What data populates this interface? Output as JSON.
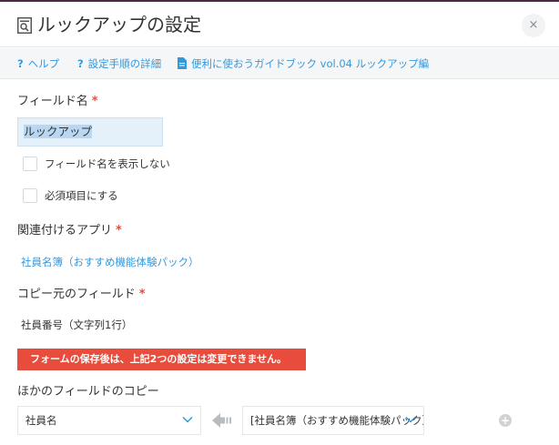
{
  "header": {
    "title": "ルックアップの設定",
    "title_icon": "lookup-search-icon",
    "close_label": "×"
  },
  "helpbar": {
    "links": [
      {
        "icon": "question-icon",
        "icon_glyph": "?",
        "label": "ヘルプ"
      },
      {
        "icon": "question-icon",
        "icon_glyph": "?",
        "label": "設定手順の詳細"
      },
      {
        "icon": "document-icon",
        "label": "便利に使おうガイドブック vol.04 ルックアップ編"
      }
    ]
  },
  "form": {
    "field_name": {
      "label": "フィールド名",
      "required_mark": "*",
      "value": "ルックアップ"
    },
    "options": [
      {
        "label": "フィールド名を表示しない",
        "checked": false
      },
      {
        "label": "必須項目にする",
        "checked": false
      }
    ],
    "related_app": {
      "label": "関連付けるアプリ",
      "required_mark": "*",
      "value": "社員名簿（おすすめ機能体験パック）"
    },
    "copy_source": {
      "label": "コピー元のフィールド",
      "required_mark": "*",
      "value": "社員番号（文字列1行）"
    },
    "warning": "フォームの保存後は、上記2つの設定は変更できません。",
    "field_mapping": {
      "label": "ほかのフィールドのコピー",
      "target_value": "社員名",
      "source_value": "[社員名簿（おすすめ機能体験パック）]",
      "arrow_icon": "arrow-left-icon",
      "add_icon": "add-icon",
      "add_glyph": "+"
    }
  },
  "colors": {
    "accent_link": "#3498db",
    "required": "#e74c3c",
    "warning_bg": "#e74c3c",
    "input_highlight": "#e4f1fb"
  }
}
